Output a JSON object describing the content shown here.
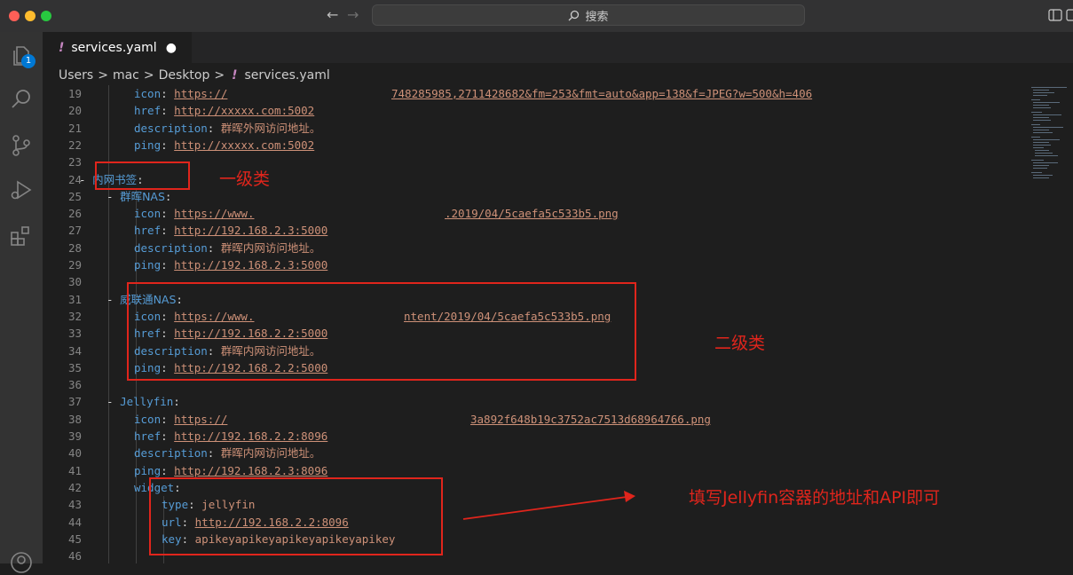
{
  "titlebar": {
    "search_label": "搜索"
  },
  "activity": {
    "explorer_badge": "1"
  },
  "tab": {
    "filename": "services.yaml",
    "marker": "!",
    "modified_dot": "●"
  },
  "breadcrumb": {
    "items": [
      "Users",
      "mac",
      "Desktop",
      "services.yaml"
    ],
    "sep": ">"
  },
  "editor": {
    "lines": [
      {
        "n": "19",
        "indent": 1,
        "key": "icon",
        "val": "https://",
        "val2": "748285985,2711428682&fm=253&fmt=auto&app=138&f=JPEG?w=500&h=406"
      },
      {
        "n": "20",
        "indent": 1,
        "key": "href",
        "val": "http://xxxxx.com:5002"
      },
      {
        "n": "21",
        "indent": 1,
        "key": "description",
        "val": "群晖外网访问地址。"
      },
      {
        "n": "22",
        "indent": 1,
        "key": "ping",
        "val": "http://xxxxx.com:5002"
      },
      {
        "n": "23"
      },
      {
        "n": "24",
        "indent": -1,
        "key": "内网书签"
      },
      {
        "n": "25",
        "indent": 0,
        "key": "群晖NAS"
      },
      {
        "n": "26",
        "indent": 1,
        "key": "icon",
        "val": "https://www.",
        "val2": ".2019/04/5caefa5c533b5.png"
      },
      {
        "n": "27",
        "indent": 1,
        "key": "href",
        "val": "http://192.168.2.3:5000"
      },
      {
        "n": "28",
        "indent": 1,
        "key": "description",
        "val": "群晖内网访问地址。"
      },
      {
        "n": "29",
        "indent": 1,
        "key": "ping",
        "val": "http://192.168.2.3:5000"
      },
      {
        "n": "30"
      },
      {
        "n": "31",
        "indent": 0,
        "key": "威联通NAS"
      },
      {
        "n": "32",
        "indent": 1,
        "key": "icon",
        "val": "https://www.",
        "val2": "ntent/2019/04/5caefa5c533b5.png"
      },
      {
        "n": "33",
        "indent": 1,
        "key": "href",
        "val": "http://192.168.2.2:5000"
      },
      {
        "n": "34",
        "indent": 1,
        "key": "description",
        "val": "群晖内网访问地址。"
      },
      {
        "n": "35",
        "indent": 1,
        "key": "ping",
        "val": "http://192.168.2.2:5000"
      },
      {
        "n": "36"
      },
      {
        "n": "37",
        "indent": 0,
        "key": "Jellyfin"
      },
      {
        "n": "38",
        "indent": 1,
        "key": "icon",
        "val": "https://",
        "val2": "3a892f648b19c3752ac7513d68964766.png"
      },
      {
        "n": "39",
        "indent": 1,
        "key": "href",
        "val": "http://192.168.2.2:8096"
      },
      {
        "n": "40",
        "indent": 1,
        "key": "description",
        "val": "群晖内网访问地址。"
      },
      {
        "n": "41",
        "indent": 1,
        "key": "ping",
        "val": "http://192.168.2.3:8096"
      },
      {
        "n": "42",
        "indent": 1,
        "key": "widget"
      },
      {
        "n": "43",
        "indent": 2,
        "key": "type",
        "val": "jellyfin"
      },
      {
        "n": "44",
        "indent": 2,
        "key": "url",
        "val": "http://192.168.2.2:8096"
      },
      {
        "n": "45",
        "indent": 2,
        "key": "key",
        "val": "apikeyapikeyapikeyapikeyapikey"
      },
      {
        "n": "46"
      }
    ]
  },
  "annotations": {
    "level1": "一级类",
    "level2": "二级类",
    "jellyfin_note": "填写Jellyfin容器的地址和API即可"
  },
  "colors": {
    "annotation": "#e0251c",
    "key": "#569cd6",
    "string": "#ce9178",
    "line_number": "#858585"
  }
}
